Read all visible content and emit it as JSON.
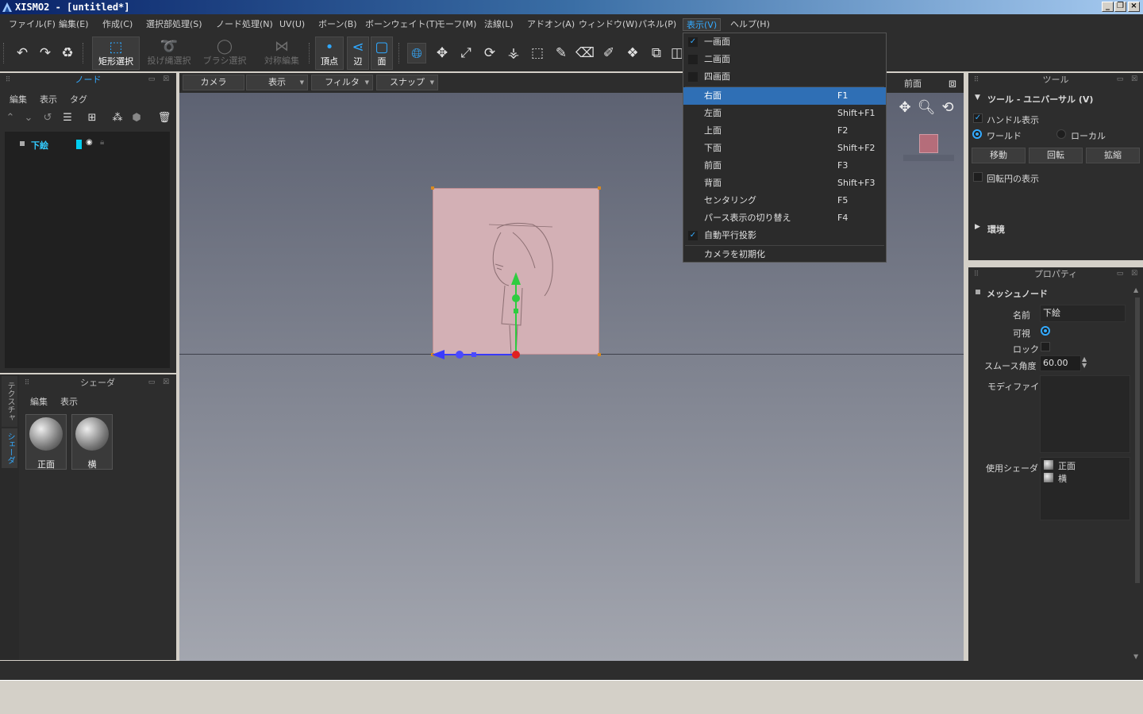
{
  "window": {
    "title": "XISMO2 - [untitled*]"
  },
  "menubar": [
    "ファイル(F)",
    "編集(E)",
    "作成(C)",
    "選択部処理(S)",
    "ノード処理(N)",
    "UV(U)",
    "ボーン(B)",
    "ボーンウェイト(T)",
    "モーフ(M)",
    "法線(L)",
    "アドオン(A)",
    "ウィンドウ(W)",
    "パネル(P)",
    "表示(V)",
    "ヘルプ(H)"
  ],
  "toolbar": {
    "rect_select": "矩形選択",
    "lasso_select": "投げ縄選択",
    "brush_select": "ブラシ選択",
    "symmetric_edit": "対称編集",
    "vertex": "頂点",
    "edge": "辺",
    "face": "面"
  },
  "node_panel": {
    "title": "ノード",
    "tabs": [
      "編集",
      "表示",
      "タグ"
    ],
    "items": [
      {
        "name": "下絵"
      }
    ]
  },
  "shader_panel": {
    "title": "シェーダ",
    "tabs": [
      "編集",
      "表示"
    ],
    "materials": [
      "正面",
      "横"
    ]
  },
  "side_tabs": [
    "テクスチャ",
    "シェーダ"
  ],
  "viewport": {
    "dropdowns": [
      "カメラ",
      "表示",
      "フィルタ",
      "スナップ"
    ],
    "view_label": "前面"
  },
  "view_menu": {
    "items": [
      {
        "label": "一画面",
        "checked": true,
        "key": ""
      },
      {
        "label": "二画面",
        "checked": false,
        "key": ""
      },
      {
        "label": "四画面",
        "checked": false,
        "key": ""
      },
      {
        "label": "右面",
        "key": "F1",
        "selected": true
      },
      {
        "label": "左面",
        "key": "Shift+F1"
      },
      {
        "label": "上面",
        "key": "F2"
      },
      {
        "label": "下面",
        "key": "Shift+F2"
      },
      {
        "label": "前面",
        "key": "F3"
      },
      {
        "label": "背面",
        "key": "Shift+F3"
      },
      {
        "label": "センタリング",
        "key": "F5"
      },
      {
        "label": "パース表示の切り替え",
        "key": "F4"
      },
      {
        "label": "自動平行投影",
        "checked": true,
        "key": ""
      },
      {
        "label": "カメラを初期化",
        "key": ""
      }
    ]
  },
  "tool_panel": {
    "title": "ツール",
    "header": "ツール - ユニバーサル (V)",
    "handle_display": "ハンドル表示",
    "world": "ワールド",
    "local": "ローカル",
    "buttons": [
      "移動",
      "回転",
      "拡縮"
    ],
    "rotation_circle": "回転円の表示",
    "environment": "環境"
  },
  "property_panel": {
    "title": "プロパティ",
    "node_type": "メッシュノード",
    "name_label": "名前",
    "name_value": "下絵",
    "visible_label": "可視",
    "lock_label": "ロック",
    "smooth_label": "スムース角度",
    "smooth_value": "60.00",
    "modifier_label": "モディファイア",
    "shader_label": "使用シェーダ",
    "shaders": [
      "正面",
      "横"
    ]
  }
}
